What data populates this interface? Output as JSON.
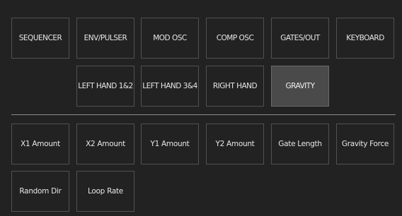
{
  "tab_rows": [
    [
      {
        "label": "SEQUENCER",
        "active": false
      },
      {
        "label": "ENV/PULSER",
        "active": false
      },
      {
        "label": "MOD OSC",
        "active": false
      },
      {
        "label": "COMP OSC",
        "active": false
      },
      {
        "label": "GATES/OUT",
        "active": false
      },
      {
        "label": "KEYBOARD",
        "active": false
      }
    ],
    [
      {
        "label": "LEFT HAND 1&2",
        "active": false
      },
      {
        "label": "LEFT HAND 3&4",
        "active": false
      },
      {
        "label": "RIGHT HAND",
        "active": false
      },
      {
        "label": "GRAVITY",
        "active": true
      }
    ]
  ],
  "param_rows": [
    [
      "X1 Amount",
      "X2 Amount",
      "Y1 Amount",
      "Y2 Amount",
      "Gate Length",
      "Gravity Force"
    ],
    [
      "Random Dir",
      "Loop Rate"
    ]
  ],
  "colors": {
    "background": "#222222",
    "button_border": "#515151",
    "active_fill": "#4a4a4a",
    "divider": "#8a8a8a",
    "text": "#e6e6e6"
  }
}
